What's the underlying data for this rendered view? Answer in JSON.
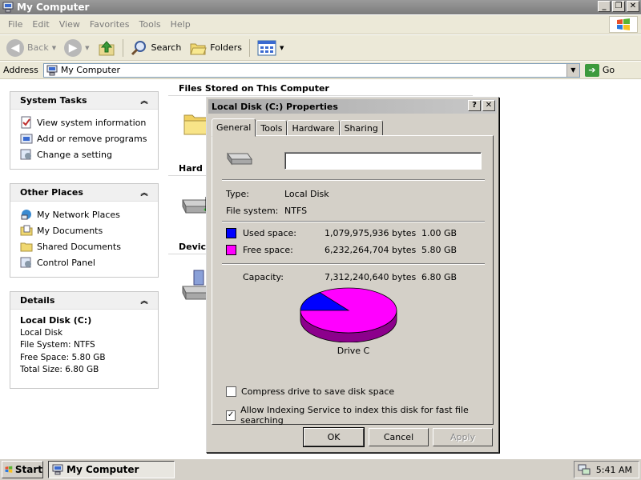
{
  "window": {
    "title": "My Computer"
  },
  "menu": [
    "File",
    "Edit",
    "View",
    "Favorites",
    "Tools",
    "Help"
  ],
  "toolbar": {
    "back": "Back",
    "search": "Search",
    "folders": "Folders"
  },
  "address": {
    "label": "Address",
    "value": "My Computer",
    "go": "Go"
  },
  "left_panels": {
    "system_tasks": {
      "title": "System Tasks",
      "items": [
        "View system information",
        "Add or remove programs",
        "Change a setting"
      ]
    },
    "other_places": {
      "title": "Other Places",
      "items": [
        "My Network Places",
        "My Documents",
        "Shared Documents",
        "Control Panel"
      ]
    },
    "details": {
      "title": "Details",
      "name": "Local Disk (C:)",
      "type": "Local Disk",
      "fs": "File System: NTFS",
      "free": "Free Space: 5.80 GB",
      "total": "Total Size: 6.80 GB"
    }
  },
  "content": {
    "section1": "Files Stored on This Computer",
    "section2": "Hard D",
    "section3": "Device"
  },
  "dialog": {
    "title": "Local Disk (C:) Properties",
    "tabs": [
      "General",
      "Tools",
      "Hardware",
      "Sharing"
    ],
    "label_value": "",
    "type_label": "Type:",
    "type_value": "Local Disk",
    "fs_label": "File system:",
    "fs_value": "NTFS",
    "used_label": "Used space:",
    "used_bytes": "1,079,975,936 bytes",
    "used_gb": "1.00 GB",
    "free_label": "Free space:",
    "free_bytes": "6,232,264,704 bytes",
    "free_gb": "5.80 GB",
    "cap_label": "Capacity:",
    "cap_bytes": "7,312,240,640 bytes",
    "cap_gb": "6.80 GB",
    "drive_label": "Drive C",
    "compress_label": "Compress drive to save disk space",
    "compress_checked": false,
    "index_label": "Allow Indexing Service to index this disk for fast file searching",
    "index_checked": true,
    "ok": "OK",
    "cancel": "Cancel",
    "apply": "Apply",
    "used_fraction": 0.148,
    "used_color": "#0000ff",
    "free_color": "#ff00ff"
  },
  "taskbar": {
    "start": "Start",
    "task": "My Computer",
    "clock": "5:41 AM"
  }
}
